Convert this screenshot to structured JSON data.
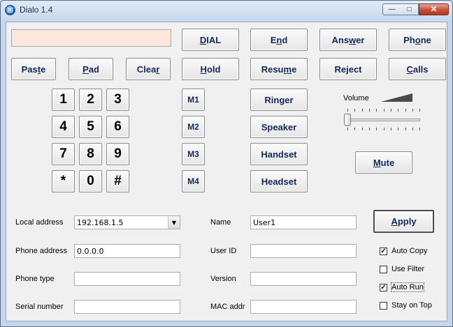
{
  "window": {
    "title": "Dialo 1.4"
  },
  "display": {
    "value": ""
  },
  "buttons": {
    "dial": {
      "pre": "",
      "ul": "D",
      "post": "IAL"
    },
    "end": {
      "pre": "E",
      "ul": "n",
      "post": "d"
    },
    "answer": {
      "pre": "Ans",
      "ul": "w",
      "post": "er"
    },
    "phone": {
      "pre": "Ph",
      "ul": "o",
      "post": "ne"
    },
    "paste": {
      "pre": "Pas",
      "ul": "t",
      "post": "e"
    },
    "pad": {
      "pre": "",
      "ul": "P",
      "post": "ad"
    },
    "clear": {
      "pre": "Clea",
      "ul": "r",
      "post": ""
    },
    "hold": {
      "pre": "",
      "ul": "H",
      "post": "old"
    },
    "resume": {
      "pre": "Resu",
      "ul": "m",
      "post": "e"
    },
    "reject": {
      "pre": "Reject",
      "ul": "",
      "post": ""
    },
    "calls": {
      "pre": "",
      "ul": "C",
      "post": "alls"
    },
    "ringer": "Ringer",
    "speaker": "Speaker",
    "handset": "Handset",
    "headset": "Headset",
    "mute": {
      "pre": "",
      "ul": "M",
      "post": "ute"
    },
    "apply": {
      "pre": "",
      "ul": "A",
      "post": "pply"
    }
  },
  "keypad": [
    "1",
    "2",
    "3",
    "4",
    "5",
    "6",
    "7",
    "8",
    "9",
    "*",
    "0",
    "#"
  ],
  "memory": [
    "M1",
    "M2",
    "M3",
    "M4"
  ],
  "volume": {
    "label": "Volume",
    "level": 0
  },
  "fields": {
    "local_address": {
      "label": "Local address",
      "value": "192.168.1.5"
    },
    "phone_address": {
      "label": "Phone address",
      "value": "0.0.0.0"
    },
    "phone_type": {
      "label": "Phone type",
      "value": ""
    },
    "serial_number": {
      "label": "Serial number",
      "value": ""
    },
    "name": {
      "label": "Name",
      "value": "User1"
    },
    "user_id": {
      "label": "User ID",
      "value": ""
    },
    "version": {
      "label": "Version",
      "value": ""
    },
    "mac_addr": {
      "label": "MAC addr",
      "value": ""
    }
  },
  "options": [
    {
      "label": "Auto Copy",
      "checked": true
    },
    {
      "label": "Use Filter",
      "checked": false
    },
    {
      "label": "Auto Run",
      "checked": true
    },
    {
      "label": "Stay on Top",
      "checked": false
    }
  ]
}
